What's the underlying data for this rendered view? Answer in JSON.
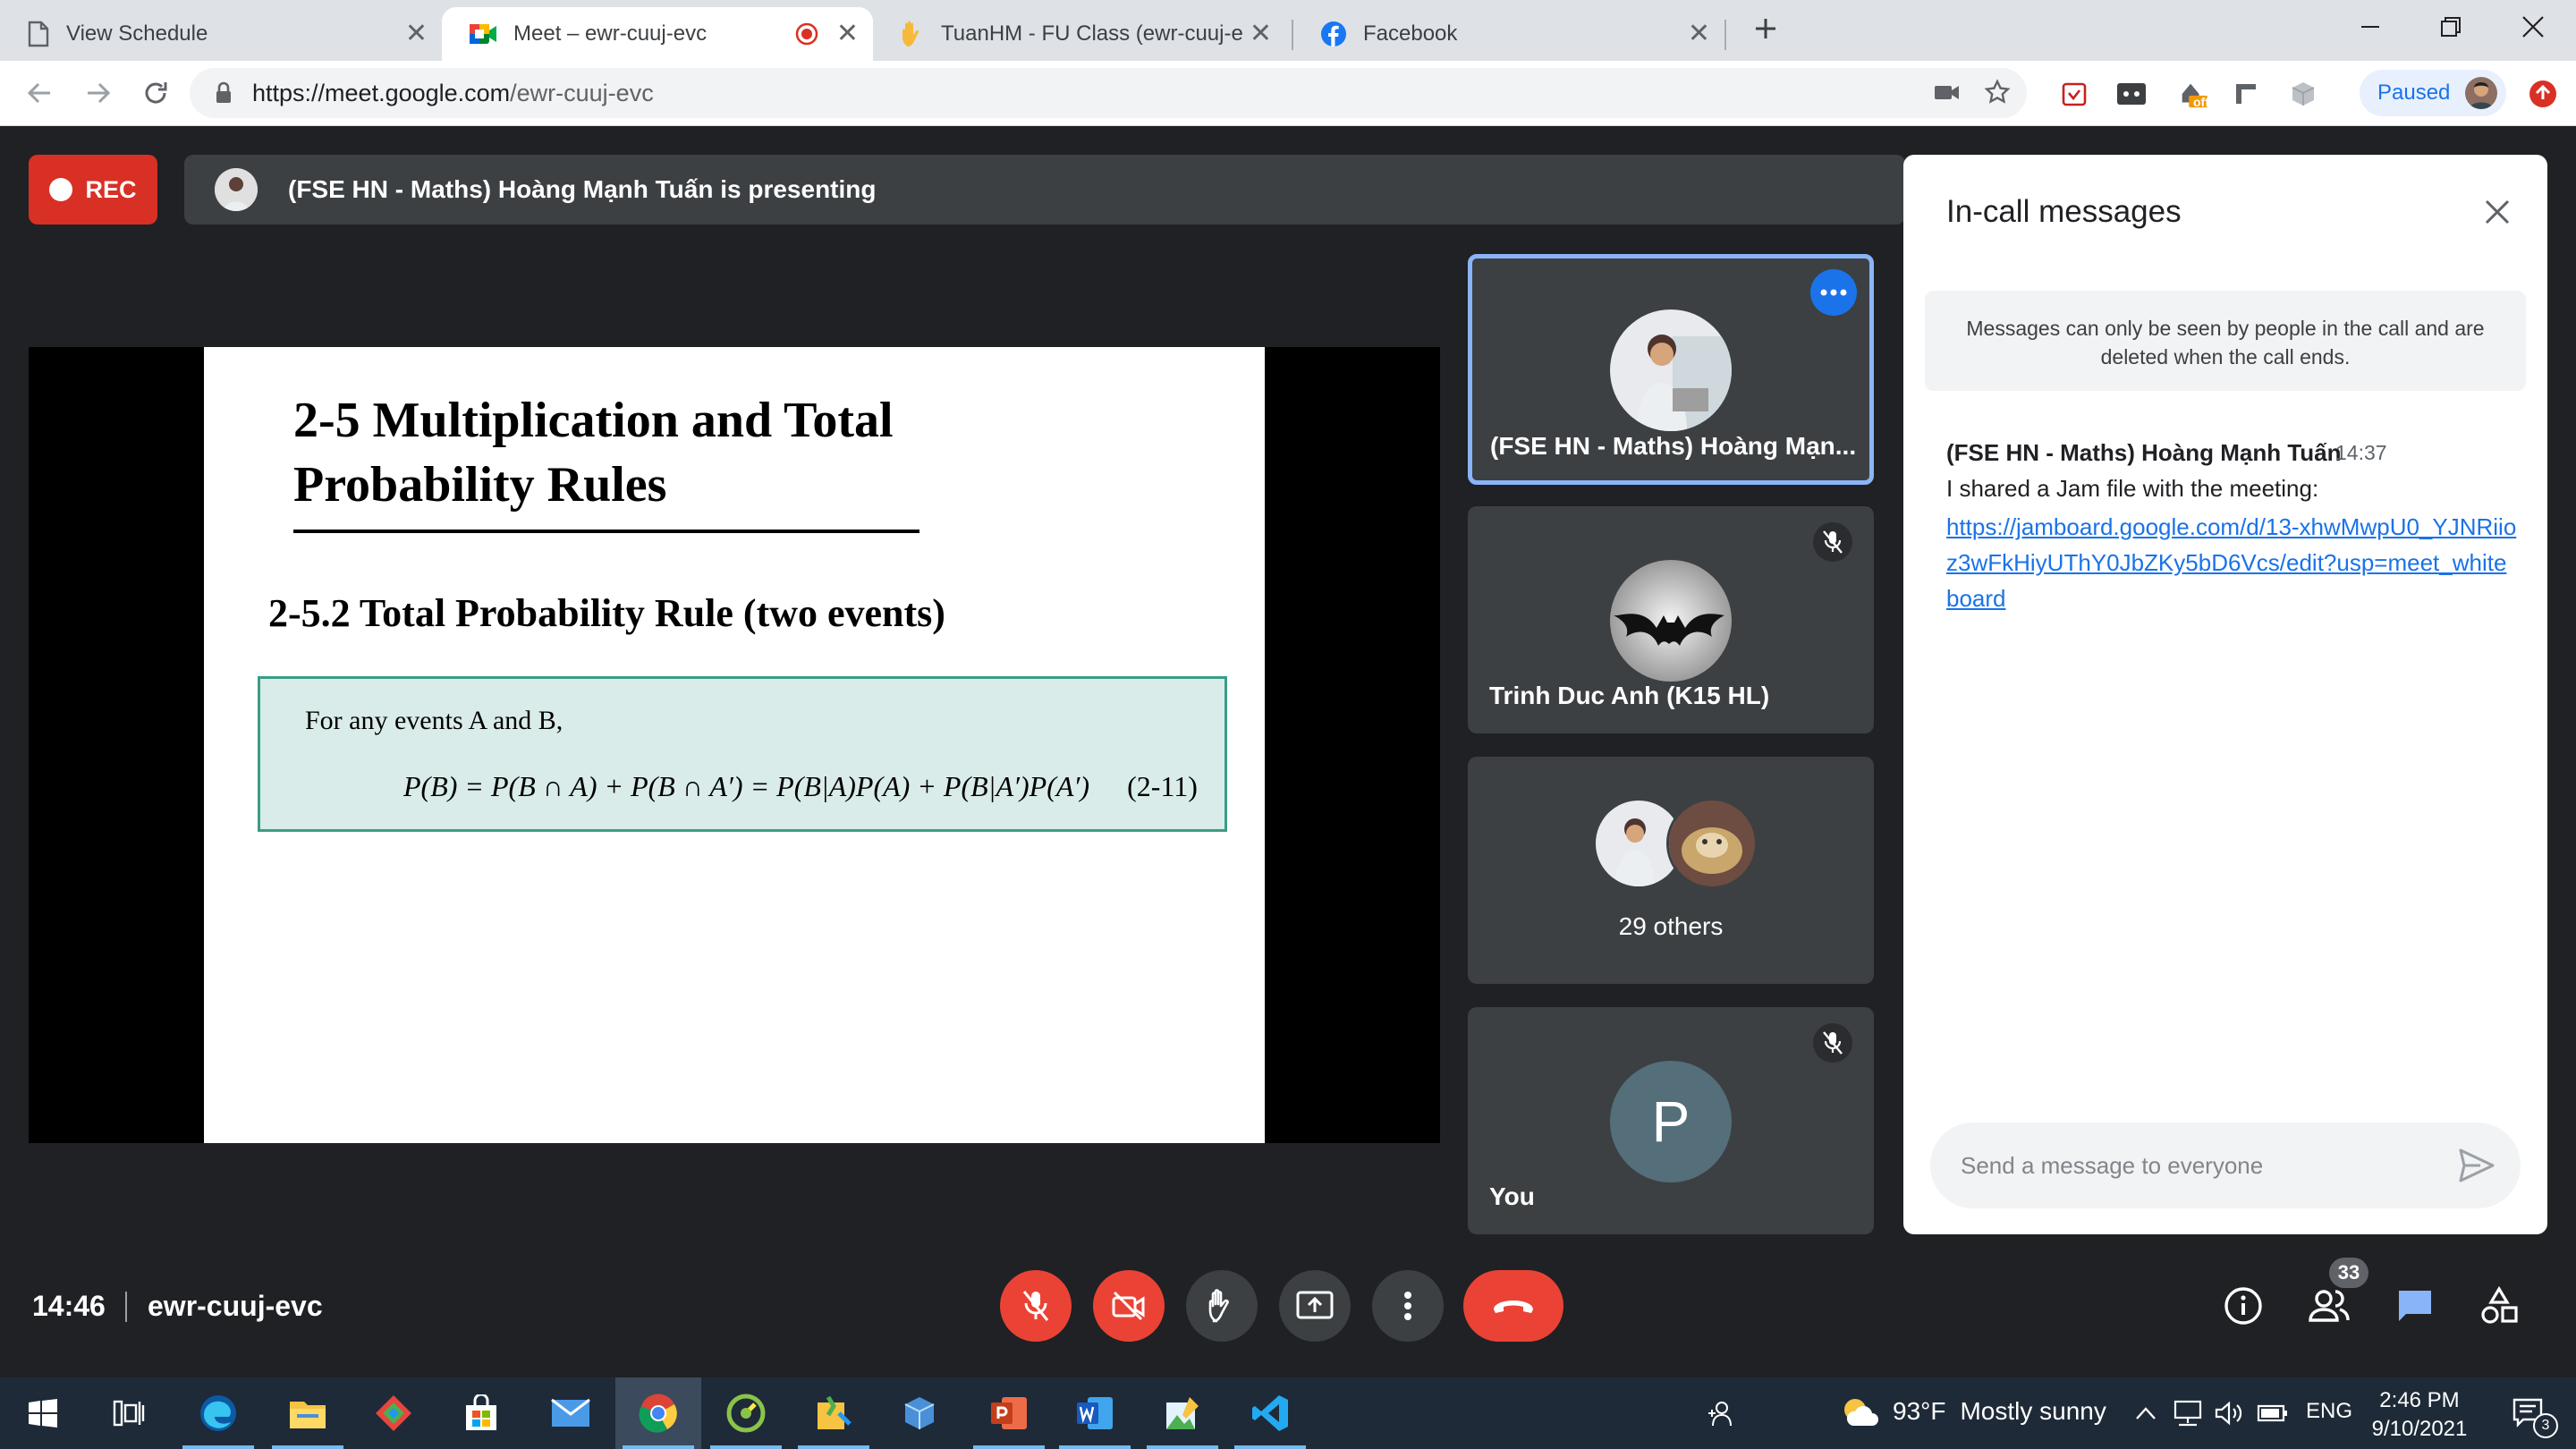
{
  "browser": {
    "tabs": [
      {
        "title": "View Schedule",
        "icon": "document-icon",
        "active": false
      },
      {
        "title": "Meet – ewr-cuuj-evc",
        "icon": "google-meet-icon",
        "active": true,
        "recording": true
      },
      {
        "title": "TuanHM - FU Class (ewr-cuuj-evc",
        "icon": "hand-icon",
        "active": false
      },
      {
        "title": "Facebook",
        "icon": "facebook-icon",
        "active": false
      }
    ],
    "url_host": "https://meet.google.com",
    "url_path": "/ewr-cuuj-evc",
    "profile_status": "Paused",
    "extension_badge": "off"
  },
  "meet": {
    "rec_label": "REC",
    "presenting_text": "(FSE HN - Maths) Hoàng Mạnh Tuấn is presenting",
    "slide": {
      "title": "2-5 Multiplication and Total Probability Rules",
      "subtitle": "2-5.2 Total Probability Rule (two events)",
      "box_intro": "For any events A and B,",
      "formula": "P(B) = P(B ∩ A) + P(B ∩ A′) = P(B|A)P(A) + P(B|A′)P(A′)",
      "equation_number": "(2-11)"
    },
    "tiles": [
      {
        "name": "(FSE HN - Maths) Hoàng Mạn...",
        "type": "photo",
        "highlighted": true
      },
      {
        "name": "Trinh Duc Anh (K15 HL)",
        "type": "batman",
        "muted": true
      },
      {
        "name": "29 others",
        "type": "group"
      },
      {
        "name": "You",
        "type": "letter",
        "letter": "P",
        "muted": true
      }
    ],
    "chat": {
      "title": "In-call messages",
      "notice": "Messages can only be seen by people in the call and are deleted when the call ends.",
      "message": {
        "sender": "(FSE HN - Maths) Hoàng Mạnh Tuấn",
        "time": "14:37",
        "text": "I shared a Jam file with the meeting:",
        "link": "https://jamboard.google.com/d/13-xhwMwpU0_YJNRiioz3wFkHiyUThY0JbZKy5bD6Vcs/edit?usp=meet_whiteboard"
      },
      "input_placeholder": "Send a message to everyone"
    },
    "clock": "14:46",
    "meeting_code": "ewr-cuuj-evc",
    "participants_count": "33"
  },
  "taskbar": {
    "weather_temp": "93°F",
    "weather_desc": "Mostly sunny",
    "language": "ENG",
    "time": "2:46 PM",
    "date": "9/10/2021",
    "notification_count": "3"
  }
}
